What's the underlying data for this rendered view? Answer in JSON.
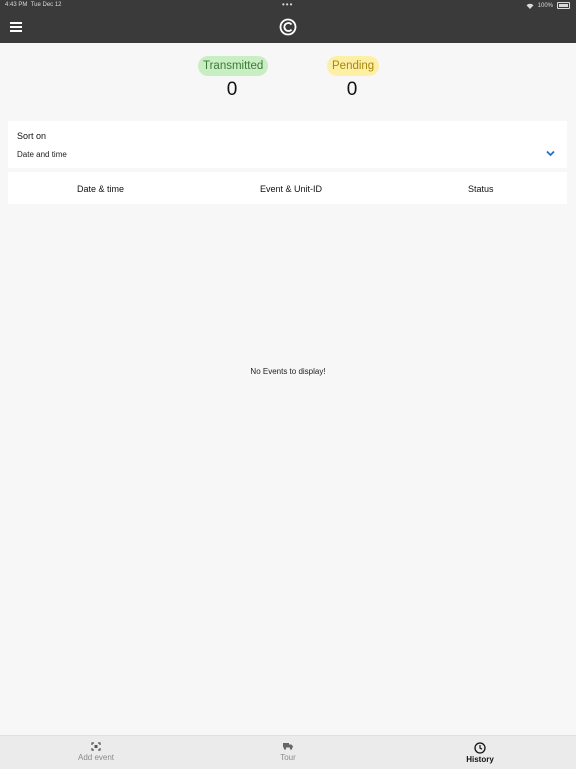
{
  "status_bar": {
    "time": "4:43 PM",
    "date": "Tue Dec 12",
    "battery": "100%"
  },
  "counters": {
    "transmitted": {
      "label": "Transmitted",
      "value": "0"
    },
    "pending": {
      "label": "Pending",
      "value": "0"
    }
  },
  "sort": {
    "label": "Sort on",
    "value": "Date and time"
  },
  "table": {
    "headers": [
      "Date & time",
      "Event & Unit-ID",
      "Status"
    ]
  },
  "empty_message": "No Events to display!",
  "tabs": [
    {
      "label": "Add event",
      "icon": "scan-icon",
      "active": false
    },
    {
      "label": "Tour",
      "icon": "truck-icon",
      "active": false
    },
    {
      "label": "History",
      "icon": "clock-icon",
      "active": true
    }
  ],
  "colors": {
    "bar": "#3a3a3a",
    "accent": "#1a73c9",
    "transmitted": "#c9eec4",
    "pending": "#fdf0a6"
  }
}
